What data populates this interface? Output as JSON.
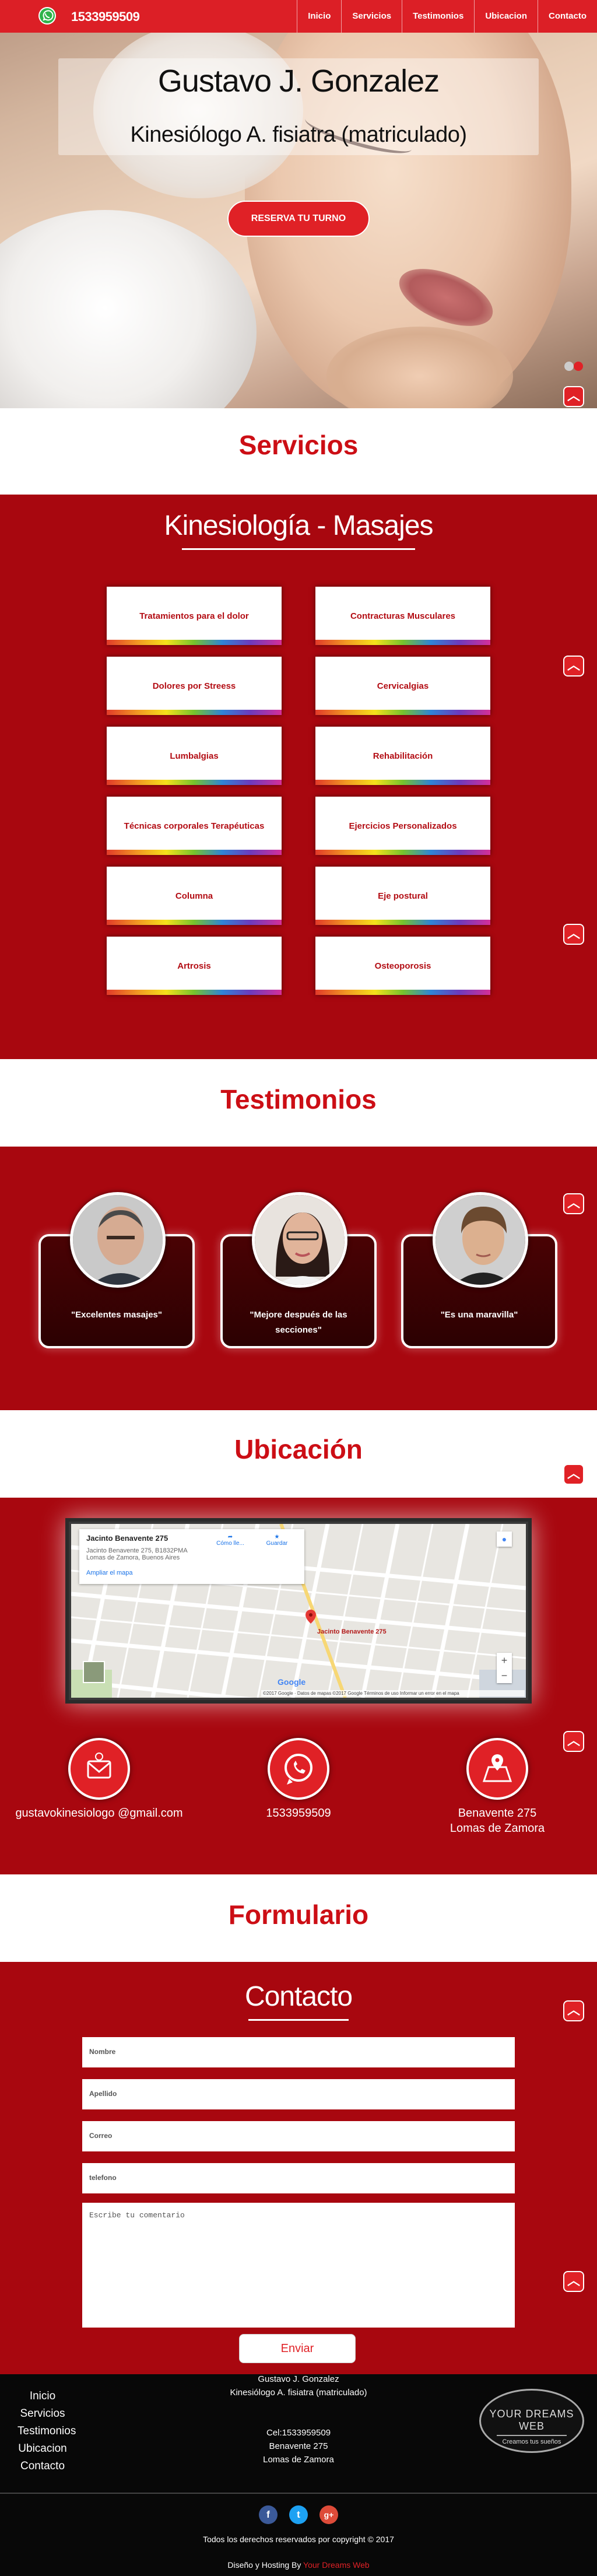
{
  "header": {
    "phone": "1533959509",
    "nav": [
      "Inicio",
      "Servicios",
      "Testimonios",
      "Ubicacion",
      "Contacto"
    ]
  },
  "hero": {
    "name": "Gustavo J. Gonzalez",
    "subtitle": "Kinesiólogo A. fisiatra (matriculado)",
    "cta": "RESERVA TU TURNO"
  },
  "servicios": {
    "heading": "Servicios",
    "subheading": "Kinesiología - Masajes",
    "items": [
      "Tratamientos para el dolor",
      "Contracturas Musculares",
      "Dolores por Streess",
      "Cervicalgias",
      "Lumbalgias",
      "Rehabilitación",
      "Técnicas corporales Terapéuticas",
      "Ejercicios Personalizados",
      "Columna",
      "Eje postural",
      "Artrosis",
      "Osteoporosis"
    ]
  },
  "testimonios": {
    "heading": "Testimonios",
    "quotes": [
      "\"Excelentes masajes\"",
      "\"Mejore después de las secciones\"",
      "\"Es una maravilla\""
    ]
  },
  "ubicacion": {
    "heading": "Ubicación",
    "map": {
      "place_title": "Jacinto Benavente 275",
      "place_address_1": "Jacinto Benavente 275, B1832PMA",
      "place_address_2": "Lomas de Zamora, Buenos Aires",
      "directions_label": "Cómo lle...",
      "save_label": "Guardar",
      "bigger_map": "Ampliar el mapa",
      "pin_label": "Jacinto Benavente 275",
      "footer": "©2017 Google · Datos de mapas ©2017 Google    Términos de uso    Informar un error en el mapa"
    },
    "email": "gustavokinesiologo @gmail.com",
    "phone": "1533959509",
    "address_1": "Benavente 275",
    "address_2": "Lomas de Zamora"
  },
  "formulario": {
    "heading": "Formulario",
    "subheading": "Contacto",
    "fields": [
      "Nombre",
      "Apellido",
      "Correo",
      "telefono"
    ],
    "textarea_placeholder": "Escribe tu comentario",
    "submit": "Enviar"
  },
  "footer": {
    "nav": [
      "Inicio",
      "Servicios",
      "Testimonios",
      "Ubicacion",
      "Contacto"
    ],
    "name": "Gustavo J. Gonzalez",
    "title": "Kinesiólogo A. fisiatra (matriculado)",
    "cel": "Cel:1533959509",
    "address_1": "Benavente 275",
    "address_2": "Lomas de Zamora",
    "badge_line1": "YOUR DREAMS WEB",
    "badge_line2": "Creamos tus sueños",
    "copyright": "Todos los derechos reservados por copyright © 2017",
    "credit_prefix": "Diseño y Hosting By",
    "credit_link": "Your Dreams Web"
  },
  "social": [
    "facebook-icon",
    "twitter-icon",
    "google-plus-icon"
  ],
  "colors": {
    "primary": "#dc1f26",
    "section_bg": "#a8070f",
    "heading": "#cc0e15"
  }
}
